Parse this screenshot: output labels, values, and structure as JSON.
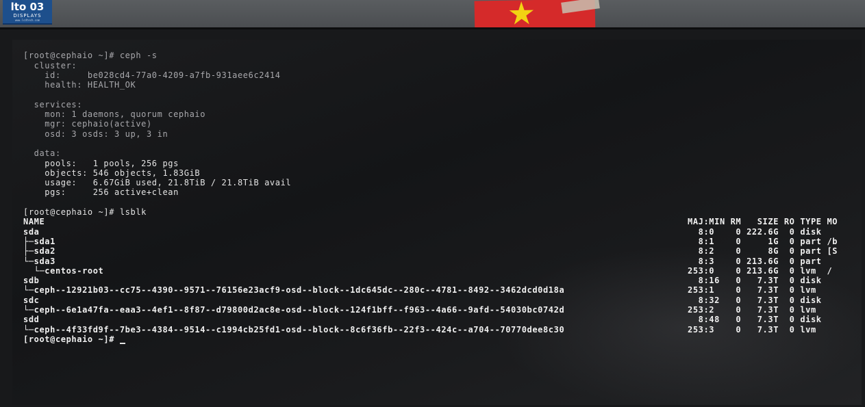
{
  "logo": {
    "main": "lto 03",
    "sub": "DISPLAYS",
    "fine": "www.lcdtech.com"
  },
  "terminal": {
    "status_cmd": "[root@cephaio ~]# ceph -s",
    "cluster_header": "  cluster:",
    "id_line": "    id:     be028cd4-77a0-4209-a7fb-931aee6c2414",
    "health_line": "    health: HEALTH_OK",
    "services_header": "  services:",
    "mon_line": "    mon: 1 daemons, quorum cephaio",
    "mgr_line": "    mgr: cephaio(active)",
    "osd_line": "    osd: 3 osds: 3 up, 3 in",
    "data_header": "  data:",
    "pools_line": "    pools:   1 pools, 256 pgs",
    "objects_line": "    objects: 546 objects, 1.83GiB",
    "usage_line": "    usage:   6.67GiB used, 21.8TiB / 21.8TiB avail",
    "pgs_line": "    pgs:     256 active+clean",
    "lsblk_cmd": "[root@cephaio ~]# lsblk",
    "lsblk_header": {
      "name": "NAME",
      "cols": "MAJ:MIN RM   SIZE RO TYPE MO"
    },
    "lsblk_rows": [
      {
        "name": "sda",
        "cols": "  8:0    0 222.6G  0 disk"
      },
      {
        "name": "├─sda1",
        "cols": "  8:1    0     1G  0 part /b"
      },
      {
        "name": "├─sda2",
        "cols": "  8:2    0     8G  0 part [S"
      },
      {
        "name": "└─sda3",
        "cols": "  8:3    0 213.6G  0 part"
      },
      {
        "name": "  └─centos-root",
        "cols": "253:0    0 213.6G  0 lvm  /"
      },
      {
        "name": "sdb",
        "cols": "  8:16   0   7.3T  0 disk"
      },
      {
        "name": "└─ceph--12921b03--cc75--4390--9571--76156e23acf9-osd--block--1dc645dc--280c--4781--8492--3462dcd0d18a",
        "cols": "253:1    0   7.3T  0 lvm"
      },
      {
        "name": "sdc",
        "cols": "  8:32   0   7.3T  0 disk"
      },
      {
        "name": "└─ceph--6e1a47fa--eaa3--4ef1--8f87--d79800d2ac8e-osd--block--124f1bff--f963--4a66--9afd--54030bc0742d",
        "cols": "253:2    0   7.3T  0 lvm"
      },
      {
        "name": "sdd",
        "cols": "  8:48   0   7.3T  0 disk"
      },
      {
        "name": "└─ceph--4f33fd9f--7be3--4384--9514--c1994cb25fd1-osd--block--8c6f36fb--22f3--424c--a704--70770dee8c30",
        "cols": "253:3    0   7.3T  0 lvm"
      }
    ],
    "final_prompt": "[root@cephaio ~]# "
  }
}
